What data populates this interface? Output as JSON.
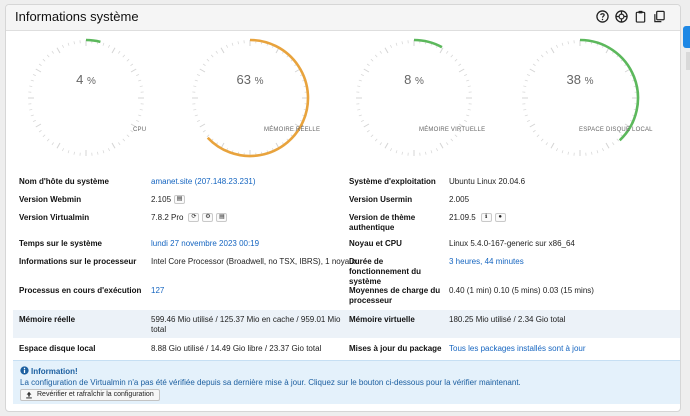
{
  "panel": {
    "title": "Informations système"
  },
  "header_icons": [
    "help-icon",
    "lifebuoy-icon",
    "clipboard-icon",
    "copy-icon"
  ],
  "colors": {
    "gauge_green": "#5cb85c",
    "gauge_orange": "#e8a33d",
    "link": "#1565c0",
    "alert_text": "#1c5fa0",
    "alert_bg": "#e4f1fb"
  },
  "gauges": [
    {
      "value": 4,
      "percent_text": "4",
      "unit": "%",
      "label": "CPU",
      "color": "#5cb85c"
    },
    {
      "value": 63,
      "percent_text": "63",
      "unit": "%",
      "label": "MÉMOIRE RÉELLE",
      "color": "#e8a33d"
    },
    {
      "value": 8,
      "percent_text": "8",
      "unit": "%",
      "label": "MÉMOIRE VIRTUELLE",
      "color": "#5cb85c"
    },
    {
      "value": 38,
      "percent_text": "38",
      "unit": "%",
      "label": "ESPACE DISQUE LOCAL",
      "color": "#5cb85c"
    }
  ],
  "info": {
    "hostname_label": "Nom d'hôte du système",
    "hostname_value": "amanet.site (207.148.23.231)",
    "os_label": "Système d'exploitation",
    "os_value": "Ubuntu Linux 20.04.6",
    "webmin_label": "Version Webmin",
    "webmin_value": "2.105",
    "usermin_label": "Version Usermin",
    "usermin_value": "2.005",
    "virtualmin_label": "Version Virtualmin",
    "virtualmin_value": "7.8.2 Pro",
    "theme_label": "Version de thème authentique",
    "theme_value": "21.09.5",
    "time_label": "Temps sur le système",
    "time_value": "lundi 27 novembre 2023 00:19",
    "kernel_label": "Noyau et CPU",
    "kernel_value": "Linux 5.4.0-167-generic sur x86_64",
    "processor_label": "Informations sur le processeur",
    "processor_value": "Intel Core Processor (Broadwell, no TSX, IBRS), 1 noyaux",
    "uptime_label": "Durée de fonctionnement du système",
    "uptime_value": "3 heures, 44 minutes",
    "processes_label": "Processus en cours d'exécution",
    "processes_value": "127",
    "load_label": "Moyennes de charge du processeur",
    "load_value": "0.40 (1 min) 0.10 (5 mins) 0.03 (15 mins)",
    "realmem_label": "Mémoire réelle",
    "realmem_value": "599.46 Mio utilisé / 125.37 Mio en cache / 959.01 Mio total",
    "virtmem_label": "Mémoire virtuelle",
    "virtmem_value": "180.25 Mio utilisé / 2.34 Gio total",
    "disk_label": "Espace disque local",
    "disk_value": "8.88 Gio utilisé / 14.49 Gio libre / 23.37 Gio total",
    "updates_label": "Mises à jour du package",
    "updates_value": "Tous les packages installés sont à jour"
  },
  "alert": {
    "title": "Information!",
    "text": "La configuration de Virtualmin n'a pas été vérifiée depuis sa dernière mise à jour. Cliquez sur le bouton ci-dessous pour la vérifier maintenant.",
    "button_label": "Revérifier et rafraîchir la configuration"
  }
}
